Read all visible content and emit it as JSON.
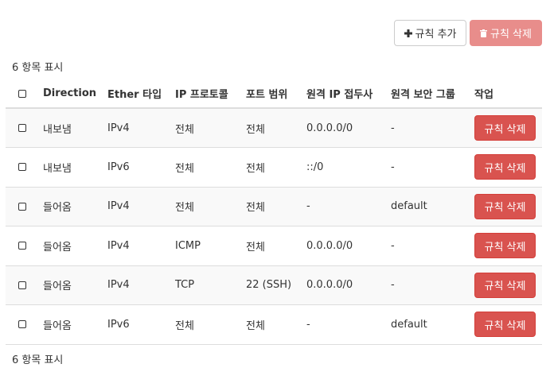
{
  "toolbar": {
    "add_rule_label": "규칙 추가",
    "delete_rules_label": "규칙 삭제"
  },
  "summary": {
    "top": "6 항목 표시",
    "bottom": "6 항목 표시"
  },
  "table": {
    "headers": [
      "Direction",
      "Ether 타입",
      "IP 프로토콜",
      "포트 범위",
      "원격 IP 접두사",
      "원격 보안 그룹",
      "작업"
    ],
    "action_label": "규칙 삭제",
    "rows": [
      {
        "direction": "내보냄",
        "ether": "IPv4",
        "protocol": "전체",
        "port": "전체",
        "remote_ip": "0.0.0.0/0",
        "remote_group": "-"
      },
      {
        "direction": "내보냄",
        "ether": "IPv6",
        "protocol": "전체",
        "port": "전체",
        "remote_ip": "::/0",
        "remote_group": "-"
      },
      {
        "direction": "들어옴",
        "ether": "IPv4",
        "protocol": "전체",
        "port": "전체",
        "remote_ip": "-",
        "remote_group": "default"
      },
      {
        "direction": "들어옴",
        "ether": "IPv4",
        "protocol": "ICMP",
        "port": "전체",
        "remote_ip": "0.0.0.0/0",
        "remote_group": "-"
      },
      {
        "direction": "들어옴",
        "ether": "IPv4",
        "protocol": "TCP",
        "port": "22 (SSH)",
        "remote_ip": "0.0.0.0/0",
        "remote_group": "-"
      },
      {
        "direction": "들어옴",
        "ether": "IPv6",
        "protocol": "전체",
        "port": "전체",
        "remote_ip": "-",
        "remote_group": "default"
      }
    ]
  },
  "colors": {
    "danger": "#d9534f",
    "danger_disabled": "#e88d8b",
    "stripe": "#f9f9f9",
    "border": "#dddddd"
  },
  "icons": {
    "add": "plus-icon",
    "delete": "trash-icon"
  }
}
